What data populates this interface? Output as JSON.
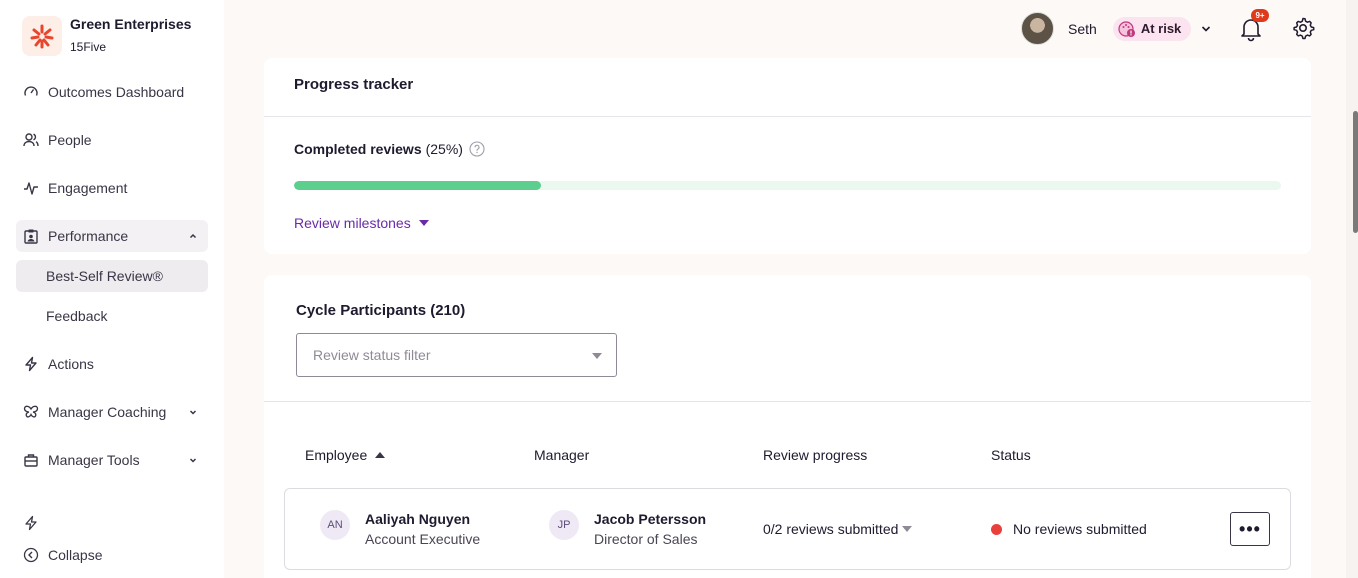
{
  "org": {
    "name": "Green Enterprises",
    "sub": "15Five"
  },
  "sidebar": {
    "items": [
      {
        "label": "Outcomes Dashboard",
        "icon": "gauge-icon"
      },
      {
        "label": "People",
        "icon": "people-icon"
      },
      {
        "label": "Engagement",
        "icon": "pulse-icon"
      },
      {
        "label": "Performance",
        "icon": "clipboard-user-icon",
        "expanded": true
      },
      {
        "label": "Best-Self Review®",
        "active": true
      },
      {
        "label": "Feedback"
      },
      {
        "label": "Actions",
        "icon": "bolt-icon"
      },
      {
        "label": "Manager Coaching",
        "icon": "butterfly-icon"
      },
      {
        "label": "Manager Tools",
        "icon": "toolbox-icon"
      }
    ],
    "collapse_label": "Collapse"
  },
  "topbar": {
    "user_name": "Seth",
    "risk_label": "At risk",
    "notifications": "9+"
  },
  "progress": {
    "title": "Progress tracker",
    "completed_label": "Completed reviews",
    "completed_pct_text": "(25%)",
    "completed_fraction": 0.25,
    "milestones_label": "Review milestones"
  },
  "participants": {
    "title": "Cycle Participants (210)",
    "filter_placeholder": "Review status filter",
    "columns": [
      "Employee",
      "Manager",
      "Review progress",
      "Status"
    ],
    "rows": [
      {
        "employee_initials": "AN",
        "employee_name": "Aaliyah Nguyen",
        "employee_role": "Account Executive",
        "manager_initials": "JP",
        "manager_name": "Jacob Petersson",
        "manager_role": "Director of Sales",
        "review_progress": "0/2 reviews submitted",
        "status": "No reviews submitted",
        "more_label": "•••"
      }
    ]
  },
  "colors": {
    "accent_purple": "#6a2ba8",
    "progress_green": "#5ccf8f",
    "status_red": "#e8413b",
    "brand_orange": "#e8452c"
  }
}
